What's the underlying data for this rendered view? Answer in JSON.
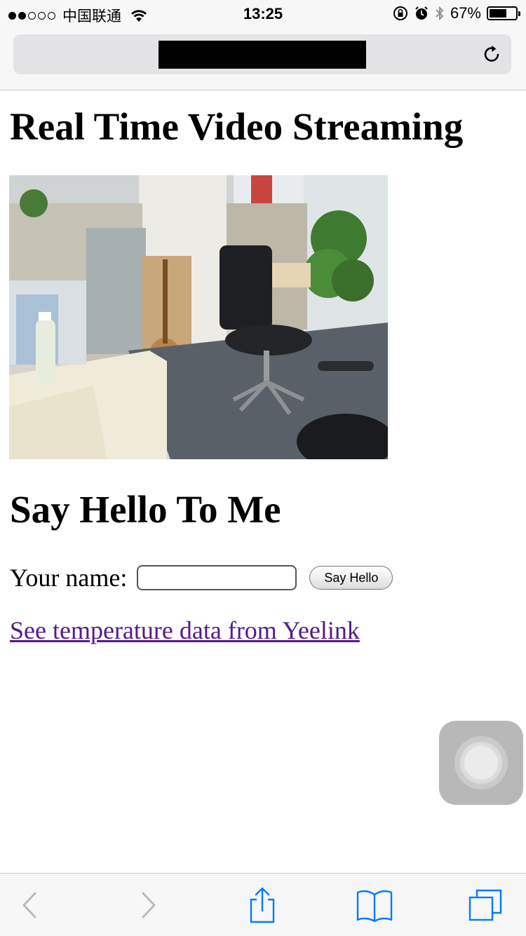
{
  "status_bar": {
    "carrier": "中国联通",
    "time": "13:25",
    "battery_percent": "67%",
    "battery_level": 0.67,
    "signal_bars_filled": 2,
    "signal_bars_total": 5
  },
  "address_bar": {
    "url_redacted": true
  },
  "page": {
    "title": "Real Time Video Streaming",
    "video_stream_image": "office-camera-feed",
    "hello_heading": "Say Hello To Me",
    "name_label": "Your name:",
    "name_input_value": "",
    "say_hello_button": "Say Hello",
    "temperature_link": "See temperature data from Yeelink"
  },
  "toolbar": {
    "icons": [
      "back-icon",
      "forward-icon",
      "share-icon",
      "bookmarks-icon",
      "tabs-icon"
    ]
  },
  "colors": {
    "link_visited": "#551a8b",
    "ios_blue": "#007aff",
    "bar_background": "#f7f7f7"
  }
}
